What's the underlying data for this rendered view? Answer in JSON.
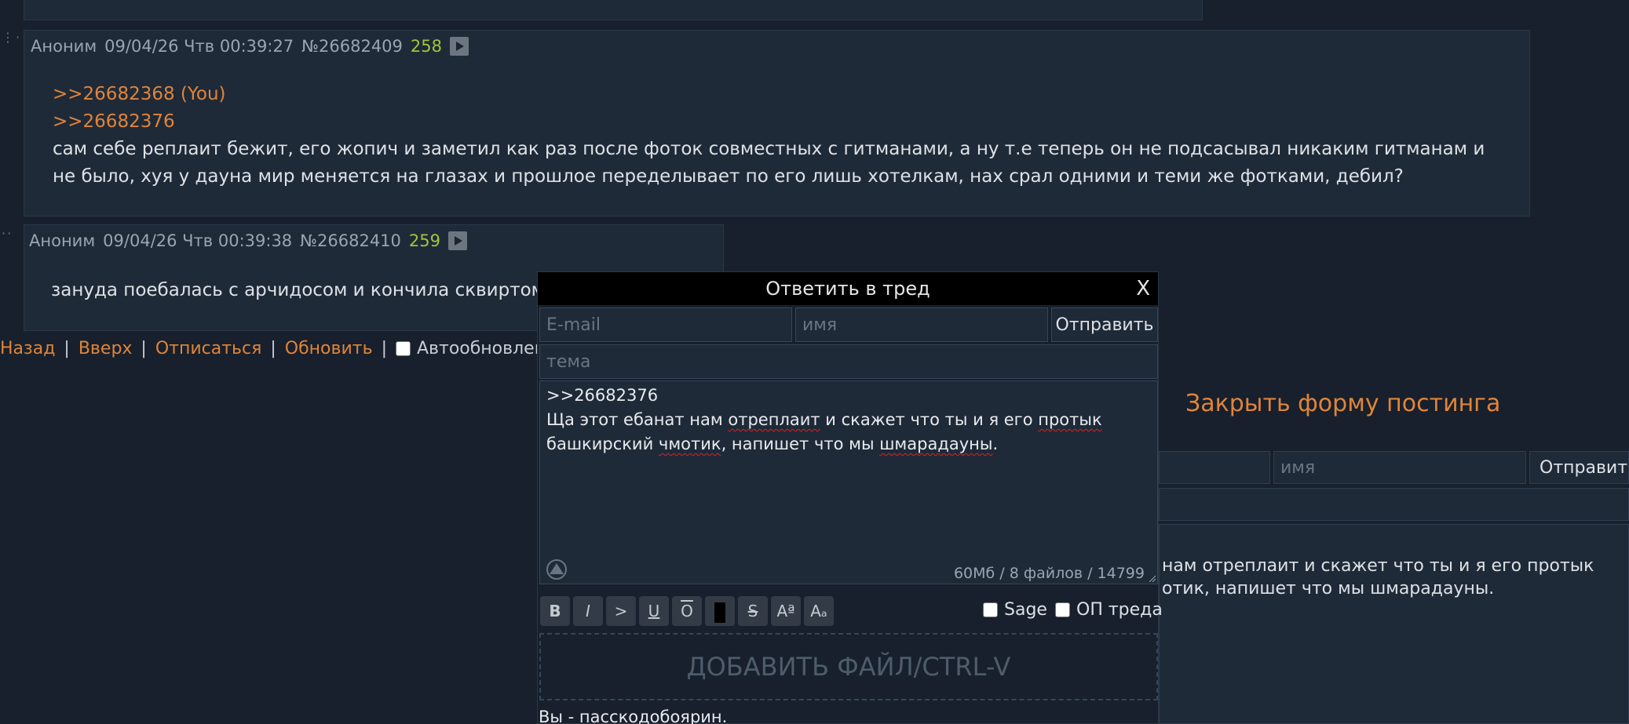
{
  "posts": [
    {
      "author": "Аноним",
      "date": "09/04/26 Чтв 00:39:27",
      "number": "№26682409",
      "count": "258",
      "replies": [
        ">>26682368 (You)",
        ">>26682376"
      ],
      "lines": [
        "сам себе реплаит бежит, его жопич и заметил как раз после фоток совместных с гитманами, а ну т.е теперь он не подсасывал никаким гитманам и",
        "не было, хуя у дауна мир меняется на глазах и прошлое переделывает по его лишь хотелкам, нах срал одними и теми же фотками, дебил?"
      ]
    },
    {
      "author": "Аноним",
      "date": "09/04/26 Чтв 00:39:38",
      "number": "№26682410",
      "count": "259",
      "lines": [
        "зануда поебалась с арчидосом и кончила сквиртом"
      ]
    }
  ],
  "nav": {
    "back": "Назад",
    "up": "Вверх",
    "unsubscribe": "Отписаться",
    "refresh": "Обновить",
    "autorefresh": "Автообновление",
    "pipe": "|"
  },
  "close_form": "Закрыть форму постинга",
  "bg_form": {
    "name_placeholder": "имя",
    "submit": "Отправить",
    "text_lines": [
      "нам отреплаит и скажет что ты и я его протык",
      "отик, напишет что мы шмарадауны."
    ]
  },
  "modal": {
    "title": "Ответить в тред",
    "close": "X",
    "email_placeholder": "E-mail",
    "name_placeholder": "имя",
    "submit": "Отправить",
    "subject_placeholder": "тема",
    "text": {
      "line1": ">>26682376",
      "line2_a": "Ща этот ебанат нам ",
      "line2_b": "отреплаит",
      "line2_c": " и скажет что ты и я его ",
      "line2_d": "протык",
      "line3_a": "башкирский ",
      "line3_b": "чмотик",
      "line3_c": ", напишет что мы ",
      "line3_d": "шмарадауны",
      "line3_e": "."
    },
    "counter": "60Мб / 8 файлов / 14799",
    "format_buttons": {
      "bold": "B",
      "italic": "I",
      "quote": ">",
      "underline": "U",
      "overline": "O",
      "strike": "S",
      "sup": "Aª",
      "sub": "Aₐ"
    },
    "sage": "Sage",
    "op": "ОП треда",
    "dropzone": "ДОБАВИТЬ ФАЙЛ/CTRL-V",
    "footer": "Вы - пасскодобоярин."
  },
  "colors": {
    "background": "#17202c",
    "post_bg": "#1f2a38",
    "link": "#e0843a",
    "count": "#a3c43c"
  }
}
